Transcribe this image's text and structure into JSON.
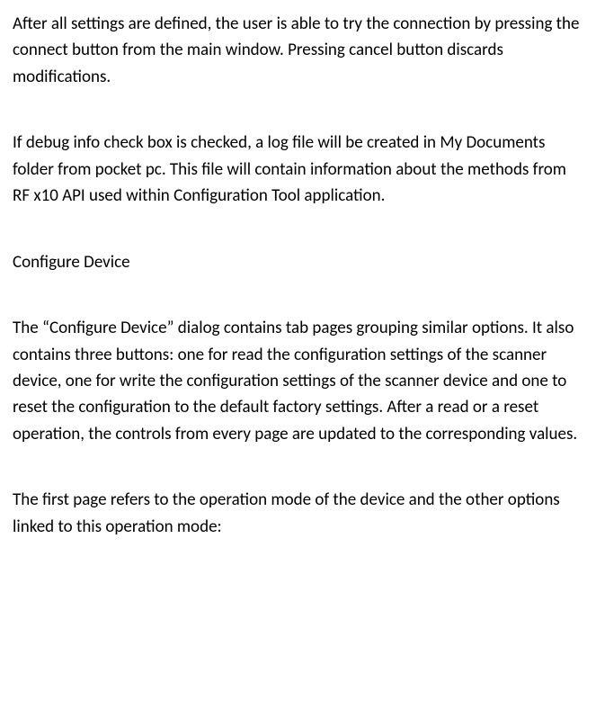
{
  "paragraphs": {
    "p1": "After all settings are defined, the user is able to try the connection by pressing the connect button from the main window. Pressing cancel button discards modifications.",
    "p2": "If debug info check box is checked, a log file will be created in My Documents folder from pocket pc. This file will contain information about the methods from RF x10 API used within Configuration Tool application.",
    "heading": "Configure Device",
    "p3": "The “Configure Device” dialog contains tab pages grouping similar options. It also contains three buttons: one for read the configuration settings of the scanner device, one for write the configuration settings of the scanner device and one to reset the configuration to the default factory settings. After a read or a reset operation, the controls from every page are updated to the corresponding values.",
    "p4": "The first page refers to the operation mode of the device and the other options linked to this operation mode:"
  }
}
